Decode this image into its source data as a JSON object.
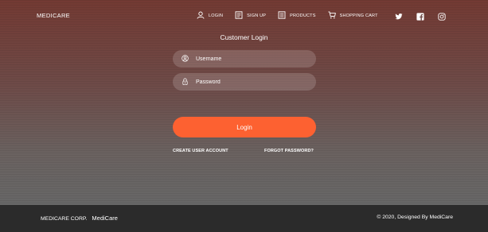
{
  "header": {
    "brand": "MEDICARE",
    "nav": [
      {
        "label": "LOGIN",
        "icon": "user-icon"
      },
      {
        "label": "SIGN UP",
        "icon": "signup-form-icon"
      },
      {
        "label": "PRODUCTS",
        "icon": "products-list-icon"
      },
      {
        "label": "SHOPPING CART",
        "icon": "shopping-cart-icon"
      }
    ],
    "social": [
      "twitter-icon",
      "facebook-icon",
      "instagram-icon"
    ]
  },
  "login": {
    "title": "Customer Login",
    "username_placeholder": "Username",
    "password_placeholder": "Password",
    "button_label": "Login",
    "create_account": "CREATE USER ACCOUNT",
    "forgot_password": "FORGOT PASSWORD?"
  },
  "footer": {
    "company": "MEDICARE CORP.",
    "name": "MediCare",
    "copyright": "© 2020, Designed By MediCare"
  },
  "colors": {
    "accent": "#fd6131",
    "footer_bg": "#2b2b2b",
    "hero_top": "#733a33",
    "hero_bottom": "#676767"
  }
}
